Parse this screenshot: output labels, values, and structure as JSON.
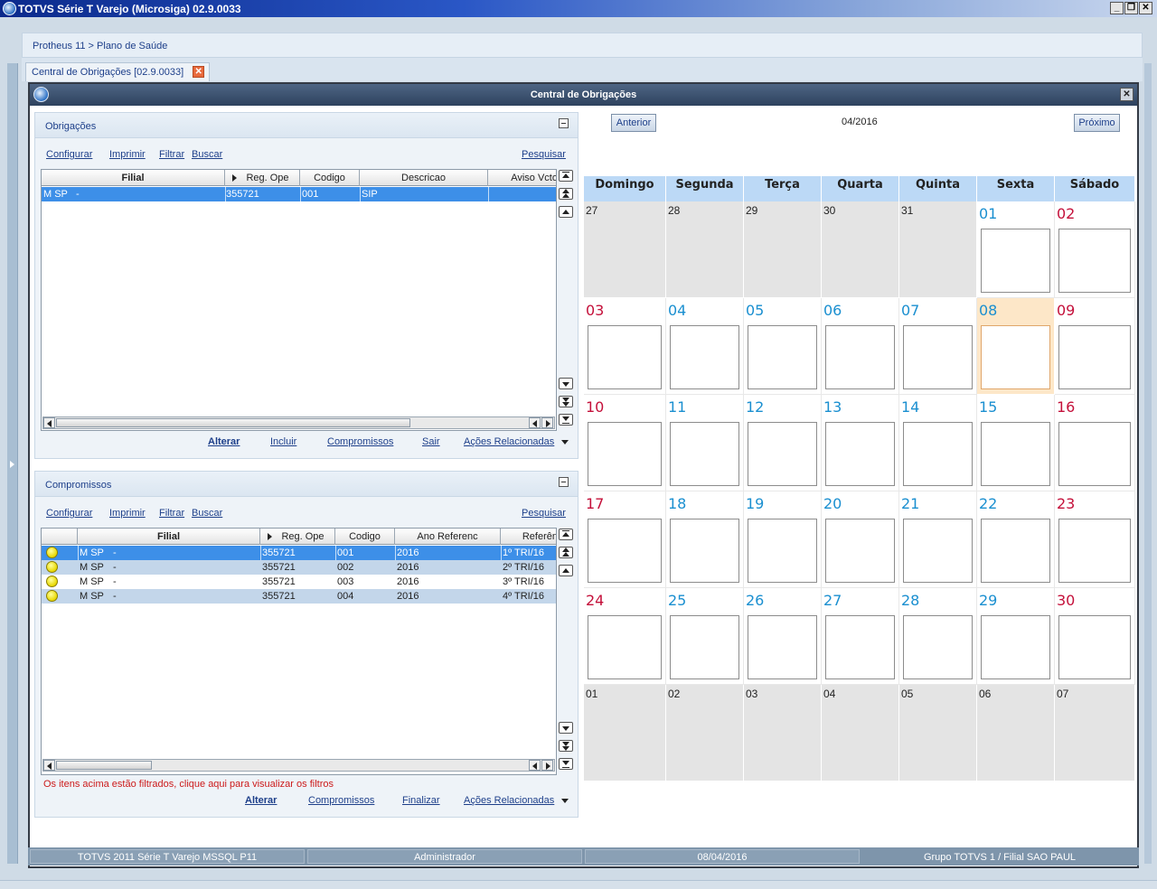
{
  "window": {
    "title": "TOTVS Série T Varejo (Microsiga) 02.9.0033",
    "buttons": [
      "_",
      "❐",
      "✕"
    ]
  },
  "breadcrumb": "Protheus 11 > Plano de Saúde",
  "tab": {
    "label": "Central de Obrigações [02.9.0033]",
    "close": "✕"
  },
  "dialog": {
    "title": "Central de Obrigações",
    "close": "✕"
  },
  "obrigacoes": {
    "title": "Obrigações",
    "menu": {
      "configurar": "Configurar",
      "imprimir": "Imprimir",
      "filtrar": "Filtrar",
      "buscar": "Buscar",
      "pesquisar": "Pesquisar"
    },
    "columns": [
      "Filial",
      "Reg. Ope",
      "Codigo",
      "Descricao",
      "Aviso Vcto"
    ],
    "rows": [
      {
        "filial": "M SP",
        "dash": "-",
        "reg_ope": "355721",
        "codigo": "001",
        "descricao": "SIP",
        "aviso": ""
      }
    ],
    "actions": {
      "alterar": "Alterar",
      "incluir": "Incluir",
      "compromissos": "Compromissos",
      "sair": "Sair",
      "acoes": "Ações Relacionadas"
    }
  },
  "compromissos": {
    "title": "Compromissos",
    "menu": {
      "configurar": "Configurar",
      "imprimir": "Imprimir",
      "filtrar": "Filtrar",
      "buscar": "Buscar",
      "pesquisar": "Pesquisar"
    },
    "columns": [
      "",
      "Filial",
      "Reg. Ope",
      "Codigo",
      "Ano Referenc",
      "Referên"
    ],
    "rows": [
      {
        "filial": "M SP",
        "dash": "-",
        "reg_ope": "355721",
        "codigo": "001",
        "ano": "2016",
        "ref": "1º TRI/16"
      },
      {
        "filial": "M SP",
        "dash": "-",
        "reg_ope": "355721",
        "codigo": "002",
        "ano": "2016",
        "ref": "2º TRI/16"
      },
      {
        "filial": "M SP",
        "dash": "-",
        "reg_ope": "355721",
        "codigo": "003",
        "ano": "2016",
        "ref": "3º TRI/16"
      },
      {
        "filial": "M SP",
        "dash": "-",
        "reg_ope": "355721",
        "codigo": "004",
        "ano": "2016",
        "ref": "4º TRI/16"
      }
    ],
    "filter_msg": "Os itens acima estão filtrados, clique aqui para visualizar os filtros",
    "actions": {
      "alterar": "Alterar",
      "compromissos": "Compromissos",
      "finalizar": "Finalizar",
      "acoes": "Ações Relacionadas"
    }
  },
  "calendar": {
    "prev": "Anterior",
    "next": "Próximo",
    "month": "04/2016",
    "days": [
      "Domingo",
      "Segunda",
      "Terça",
      "Quarta",
      "Quinta",
      "Sexta",
      "Sábado"
    ],
    "weeks": [
      [
        "27",
        "28",
        "29",
        "30",
        "31",
        "01",
        "02"
      ],
      [
        "03",
        "04",
        "05",
        "06",
        "07",
        "08",
        "09"
      ],
      [
        "10",
        "11",
        "12",
        "13",
        "14",
        "15",
        "16"
      ],
      [
        "17",
        "18",
        "19",
        "20",
        "21",
        "22",
        "23"
      ],
      [
        "24",
        "25",
        "26",
        "27",
        "28",
        "29",
        "30"
      ],
      [
        "01",
        "02",
        "03",
        "04",
        "05",
        "06",
        "07"
      ]
    ],
    "today": "08"
  },
  "statusbar": [
    "TOTVS 2011 Série T Varejo MSSQL P11",
    "Administrador",
    "08/04/2016",
    "Grupo TOTVS 1 / Filial SAO PAUL"
  ]
}
